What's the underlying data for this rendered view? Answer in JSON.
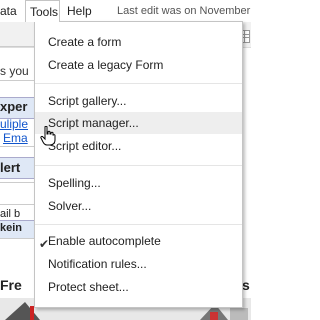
{
  "menubar": {
    "left_fragment": "ata",
    "items": [
      {
        "label": "Tools"
      },
      {
        "label": "Help"
      }
    ],
    "last_edit": "Last edit was on November"
  },
  "sheet": {
    "frag_s_you": "s you",
    "frag_xper": "xper",
    "frag_uliple": "uliple",
    "frag_ema": "Ema",
    "frag_lert": "lert",
    "frag_ail_b": "ail b",
    "frag_kein": "kein",
    "frag_fre": "Fre",
    "frag_s": "s"
  },
  "tools_menu": {
    "groups": [
      [
        "Create a form",
        "Create a legacy Form"
      ],
      [
        "Script gallery...",
        "Script manager...",
        "Script editor..."
      ],
      [
        "Spelling...",
        "Solver..."
      ],
      [
        "Enable autocomplete",
        "Notification rules...",
        "Protect sheet..."
      ]
    ],
    "hovered": "Script manager...",
    "checked": "Enable autocomplete",
    "check_glyph": "✔"
  },
  "colors": {
    "menu_hover": "#eeeeee",
    "row_header": "#dfe8f6",
    "link_blue": "#1155cc"
  }
}
